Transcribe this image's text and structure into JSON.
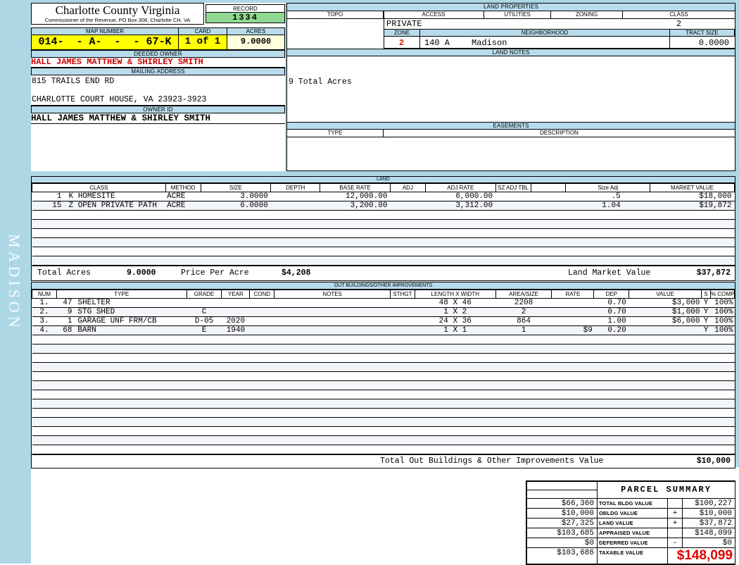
{
  "colors": {
    "page_blue": "#AED7E6",
    "bar_blue": "#B9DCEC",
    "record_green": "#90D892",
    "highlight_yellow": "#FFFF00",
    "acres_cream": "#FFFFDE",
    "owner_red": "#CC0000",
    "taxable_red": "#E00000"
  },
  "watermark": "MADISON",
  "header": {
    "title": "Charlotte County Virginia",
    "subtitle": "Commissioner of the Revenue, PO Box 308, Charlotte CH, VA",
    "record_label": "RECORD",
    "record_value": "1334",
    "map_number_label": "MAP NUMBER",
    "map_number_value": "014-  - A-  -  - 67-K",
    "card_label": "CARD",
    "card_value": "1 of 1",
    "acres_label": "ACRES",
    "acres_value": "9.0000"
  },
  "owner": {
    "deeded_owner_label": "DEEDED OWNER",
    "deeded_owner": "HALL JAMES MATTHEW & SHIRLEY SMITH",
    "mailing_address_label": "MAILING ADDRESS",
    "address_line1": "815 TRAILS END RD",
    "address_line2": "CHARLOTTE COURT HOUSE, VA 23923-3923",
    "owner_id_label": "OWNER ID",
    "owner_id": "HALL JAMES MATTHEW & SHIRLEY SMITH"
  },
  "land_properties": {
    "section_label": "LAND PROPERTIES",
    "topo_label": "TOPO",
    "access_label": "ACCESS",
    "utilities_label": "UTILITIES",
    "zoning_label": "ZONING",
    "class_label": "CLASS",
    "access_value": "PRIVATE",
    "class_value": "2",
    "zone_label": "ZONE",
    "zone_value": "2",
    "neighborhood_label": "NEIGHBORHOOD",
    "neighborhood_code": "140 A",
    "neighborhood_name": "Madison",
    "tract_size_label": "TRACT SIZE",
    "tract_size_value": "0.0000"
  },
  "land_notes": {
    "section_label": "LAND NOTES",
    "note": "9 Total Acres"
  },
  "easements": {
    "section_label": "EASEMENTS",
    "type_label": "TYPE",
    "description_label": "DESCRIPTION"
  },
  "land_table": {
    "section_label": "LAND",
    "headers": [
      "CLASS",
      "METHOD",
      "SIZE",
      "DEPTH",
      "BASE RATE",
      "ADJ",
      "ADJ RATE",
      "SZ ADJ TBL",
      "",
      "Size Adj",
      "MARKET VALUE"
    ],
    "rows": [
      {
        "code": "1",
        "name": "K HOMESITE",
        "method": "ACRE",
        "size": "3.0000",
        "depth": "",
        "base_rate": "12,000.00",
        "adj": "",
        "adj_rate": "6,000.00",
        "sz_adj_tbl": "",
        "size_adj": ".5",
        "market_value": "$18,000"
      },
      {
        "code": "15",
        "name": "Z OPEN PRIVATE PATH",
        "method": "ACRE",
        "size": "6.0000",
        "depth": "",
        "base_rate": "3,200.00",
        "adj": "",
        "adj_rate": "3,312.00",
        "sz_adj_tbl": "",
        "size_adj": "1.04",
        "market_value": "$19,872"
      }
    ],
    "totals": {
      "total_acres_label": "Total Acres",
      "total_acres": "9.0000",
      "price_per_acre_label": "Price Per Acre",
      "price_per_acre": "$4,208",
      "land_market_value_label": "Land Market Value",
      "land_market_value": "$37,872"
    }
  },
  "outbuildings": {
    "section_label": "OUT BUILDINGS/OTHER IMPROVEMENTS",
    "headers": [
      "NUM",
      "TYPE",
      "GRADE",
      "YEAR",
      "COND",
      "NOTES",
      "STHGT",
      "LENGTH X WIDTH",
      "AREA/SIZE",
      "RATE",
      "DEP",
      "VALUE",
      "S",
      "% COMP"
    ],
    "rows": [
      {
        "num": "1.",
        "code": "47",
        "name": "SHELTER",
        "grade": "",
        "year": "",
        "cond": "",
        "notes": "",
        "sthgt": "",
        "length_width": "48 X 46",
        "area": "2208",
        "rate": "",
        "dep": "0.70",
        "value": "$3,000",
        "s": "Y",
        "comp": "100%"
      },
      {
        "num": "2.",
        "code": "9",
        "name": "STG SHED",
        "grade": "C",
        "year": "",
        "cond": "",
        "notes": "",
        "sthgt": "",
        "length_width": "1 X 2",
        "area": "2",
        "rate": "",
        "dep": "0.70",
        "value": "$1,000",
        "s": "Y",
        "comp": "100%"
      },
      {
        "num": "3.",
        "code": "1",
        "name": "GARAGE UNF FRM/CB",
        "grade": "D-05",
        "year": "2020",
        "cond": "",
        "notes": "",
        "sthgt": "",
        "length_width": "24 X 36",
        "area": "864",
        "rate": "",
        "dep": "1.00",
        "value": "$6,000",
        "s": "Y",
        "comp": "100%"
      },
      {
        "num": "4.",
        "code": "68",
        "name": "BARN",
        "grade": "E",
        "year": "1940",
        "cond": "",
        "notes": "",
        "sthgt": "",
        "length_width": "1 X 1",
        "area": "1",
        "rate": "$9",
        "dep": "0.20",
        "value": "",
        "s": "Y",
        "comp": "100%"
      }
    ],
    "total_label": "Total Out Buildings & Other Improvements Value",
    "total_value": "$10,000"
  },
  "parcel_summary": {
    "title": "PARCEL SUMMARY",
    "rows": [
      {
        "left": "$66,360",
        "label": "TOTAL BLDG VALUE",
        "op": "",
        "right": "$100,227"
      },
      {
        "left": "$10,000",
        "label": "OBLDG VALUE",
        "op": "+",
        "right": "$10,000"
      },
      {
        "left": "$27,325",
        "label": "LAND VALUE",
        "op": "+",
        "right": "$37,872"
      },
      {
        "left": "$103,685",
        "label": "APPRAISED VALUE",
        "op": "",
        "right": "$148,099"
      },
      {
        "left": "$0",
        "label": "DEFERRED VALUE",
        "op": "-",
        "right": "$0"
      },
      {
        "left": "$103,686",
        "label": "TAXABLE VALUE",
        "op": "",
        "right": "$148,099"
      }
    ]
  }
}
